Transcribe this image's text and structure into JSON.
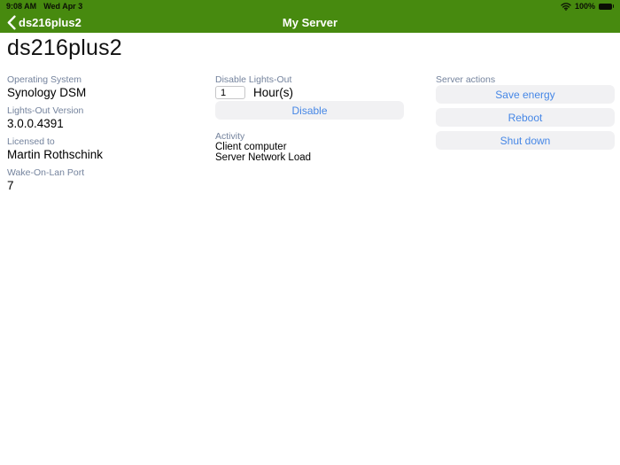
{
  "status_bar": {
    "time": "9:08 AM",
    "date": "Wed Apr 3",
    "battery": "100%"
  },
  "nav_bar": {
    "back_label": "ds216plus2",
    "title": "My Server"
  },
  "page": {
    "title": "ds216plus2"
  },
  "info": {
    "items": [
      {
        "label": "Operating System",
        "value": "Synology DSM"
      },
      {
        "label": "Lights-Out Version",
        "value": "3.0.0.4391"
      },
      {
        "label": "Licensed to",
        "value": "Martin Rothschink"
      },
      {
        "label": "Wake-On-Lan Port",
        "value": "7"
      }
    ]
  },
  "disable_section": {
    "label": "Disable Lights-Out",
    "hours_value": "1",
    "hours_unit": "Hour(s)",
    "disable_button": "Disable"
  },
  "activity": {
    "label": "Activity",
    "items": [
      "Client computer",
      "Server Network Load"
    ]
  },
  "server_actions": {
    "label": "Server actions",
    "buttons": [
      "Save energy",
      "Reboot",
      "Shut down"
    ]
  },
  "colors": {
    "nav_green": "#478A0F",
    "section_label": "#74839D",
    "button_background": "#F1F1F3",
    "button_text": "#4687E6"
  }
}
